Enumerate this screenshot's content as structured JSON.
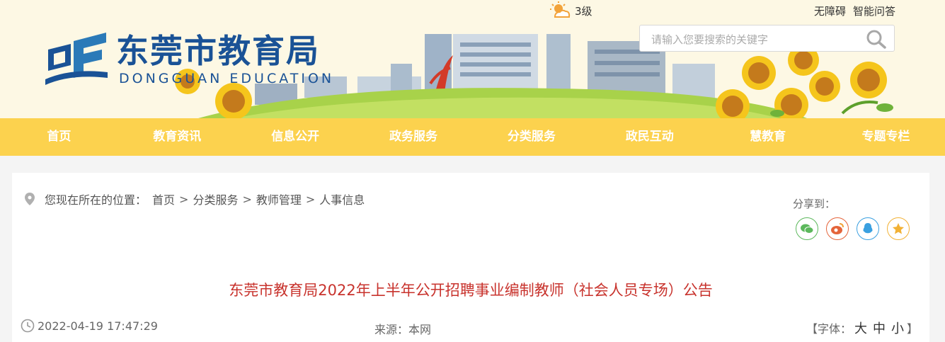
{
  "header": {
    "logo_cn": "东莞市教育局",
    "logo_en": "DONGGUAN EDUCATION",
    "weather_text": "3级",
    "weather_icon": "partly-sunny-icon",
    "top_links": [
      "无障碍",
      "智能问答"
    ],
    "search_placeholder": "请输入您要搜索的关键字",
    "search_icon": "search-icon"
  },
  "nav": {
    "items": [
      "首页",
      "教育资讯",
      "信息公开",
      "政务服务",
      "分类服务",
      "政民互动",
      "慧教育",
      "专题专栏"
    ]
  },
  "breadcrumb": {
    "prefix": "您现在所在的位置：",
    "items": [
      "首页",
      "分类服务",
      "教师管理",
      "人事信息"
    ]
  },
  "share": {
    "label": "分享到：",
    "icons": [
      "wechat-icon",
      "weibo-icon",
      "qq-icon",
      "favorite-icon"
    ]
  },
  "article": {
    "title": "东莞市教育局2022年上半年公开招聘事业编制教师（社会人员专场）公告",
    "date": "2022-04-19 17:47:29",
    "source": "来源：本网",
    "font_prefix": "【字体：",
    "font_sizes": [
      "大",
      "中",
      "小"
    ],
    "font_suffix": "】"
  },
  "colors": {
    "nav_bg": "#fcd24e",
    "title_red": "#c8332d",
    "logo_blue": "#1a5296",
    "header_bg": "#fdf8e4"
  }
}
